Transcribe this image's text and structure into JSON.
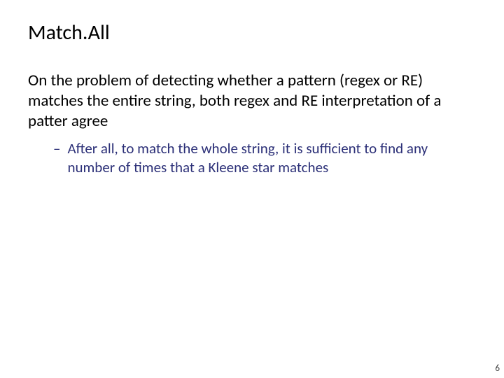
{
  "slide": {
    "title": "Match.All",
    "paragraph": "On the problem of detecting whether a pattern (regex or RE) matches the entire string, both regex and RE interpretation of a patter agree",
    "sub_dash": "–",
    "sub_text": "After all, to match the whole string, it is sufficient to find any number of times that a Kleene star matches",
    "page_number": "6"
  }
}
